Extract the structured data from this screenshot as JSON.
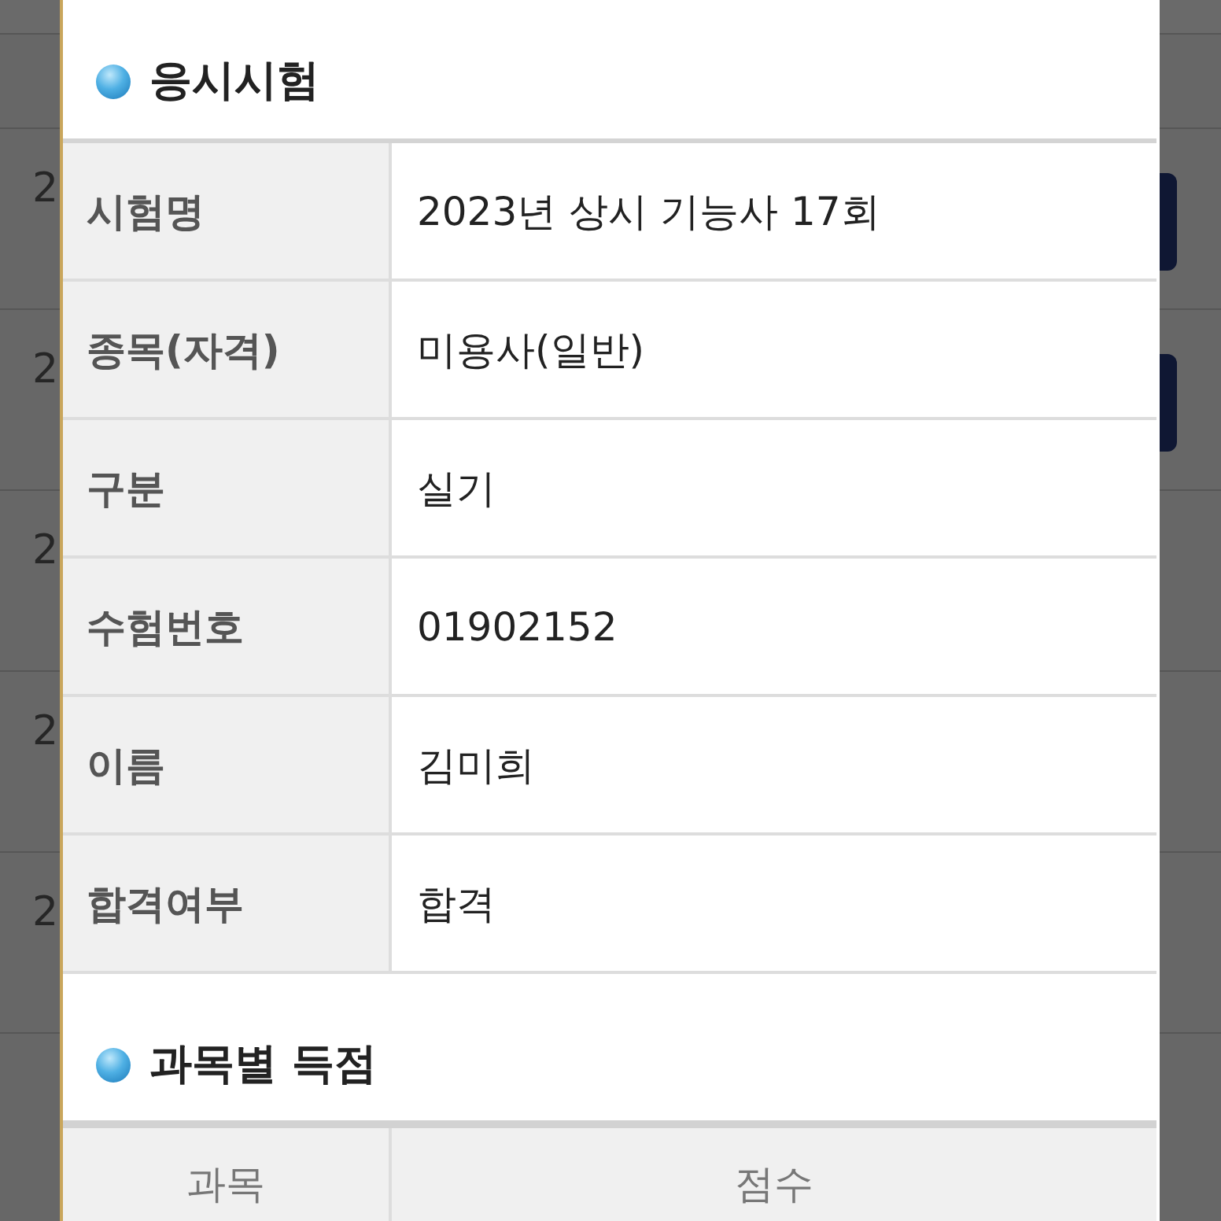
{
  "background_table": {
    "rows": [
      {
        "column_1": "2",
        "has_button": true
      },
      {
        "column_1": "2",
        "has_button": true
      },
      {
        "column_1": "2",
        "has_button": false
      },
      {
        "column_1": "2",
        "has_button": false
      },
      {
        "column_1": "2",
        "has_button": false
      }
    ]
  },
  "dialog": {
    "exam_section": {
      "title": "응시시험",
      "rows": [
        {
          "label": "시험명",
          "value": "2023년 상시 기능사 17회"
        },
        {
          "label": "종목(자격)",
          "value": "미용사(일반)"
        },
        {
          "label": "구분",
          "value": "실기"
        },
        {
          "label": "수험번호",
          "value": "01902152"
        },
        {
          "label": "이름",
          "value": "김미희"
        },
        {
          "label": "합격여부",
          "value": "합격"
        }
      ]
    },
    "score_section": {
      "title": "과목별 득점",
      "columns": [
        "과목",
        "점수"
      ]
    }
  }
}
